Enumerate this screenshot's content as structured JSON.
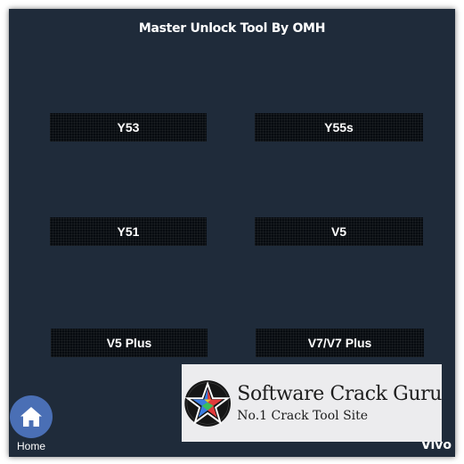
{
  "window": {
    "title": "Master Unlock Tool By OMH",
    "background": "#1f2b3a"
  },
  "models": [
    {
      "label": "Y53"
    },
    {
      "label": "Y55s"
    },
    {
      "label": "Y51"
    },
    {
      "label": "V5"
    },
    {
      "label": "V5 Plus"
    },
    {
      "label": "V7/V7 Plus"
    }
  ],
  "home": {
    "label": "Home",
    "icon": "home-icon",
    "color": "#4a6fb5"
  },
  "brand": {
    "label": "Vivo"
  },
  "watermark": {
    "title": "Software Crack Guru",
    "subtitle": "No.1 Crack Tool Site",
    "icon": "star-logo-icon"
  }
}
